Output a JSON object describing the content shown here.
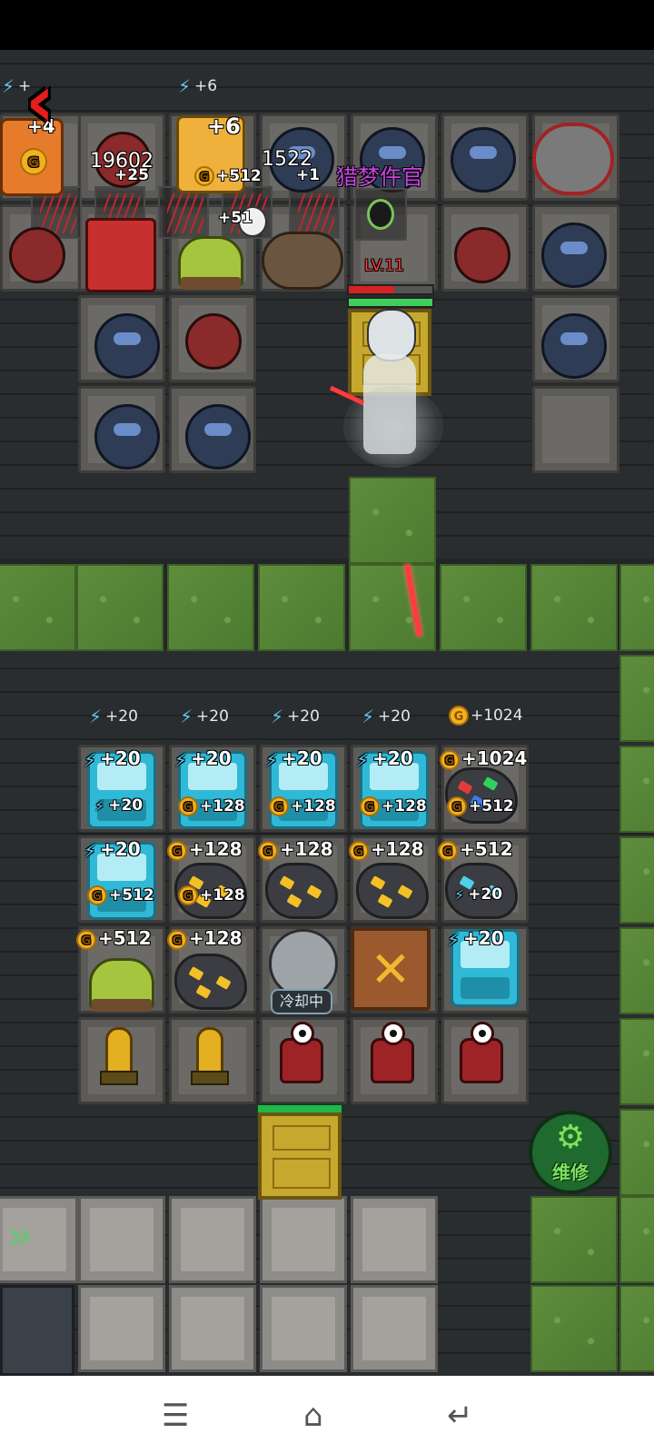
{
  "hud": {
    "gold": "19602",
    "gems": "1522",
    "boss_name": "猎梦仵官",
    "boss_level": "LV.11"
  },
  "top_labels": {
    "bolt_a": "+",
    "bolt_b": "+6",
    "room_a": "+4",
    "room_b": "+6",
    "room_b_sub": "+512",
    "room_a_sub": "+25",
    "coin_sub": "+51",
    "extra_sub": "+1"
  },
  "mid_labels": {
    "row_header": [
      "+20",
      "+20",
      "+20",
      "+20",
      "+1024"
    ],
    "row1_top": [
      "+20",
      "+20",
      "+20",
      "+20",
      "+1024"
    ],
    "row1_bottom": [
      "+20",
      "+128",
      "+128",
      "+128",
      "+512"
    ],
    "row2_top": [
      "+20",
      "+128",
      "+128",
      "+128",
      "+512"
    ],
    "row2_bottom": [
      "+512",
      "+128",
      "+20"
    ],
    "row3_top": [
      "+512",
      "+128",
      "+20"
    ]
  },
  "buttons": {
    "cooling": "冷却中",
    "repair": "维修"
  },
  "colors": {
    "boss_name": "#c845e0",
    "level_text": "#ff3b3b",
    "hp_red": "#d42424",
    "hp_green": "#3fcf5a",
    "repair_text": "#7ee25c"
  },
  "icons": [
    "back-arrow-icon",
    "bolt-icon",
    "coin-icon",
    "menu-icon",
    "home-icon",
    "back-icon"
  ]
}
